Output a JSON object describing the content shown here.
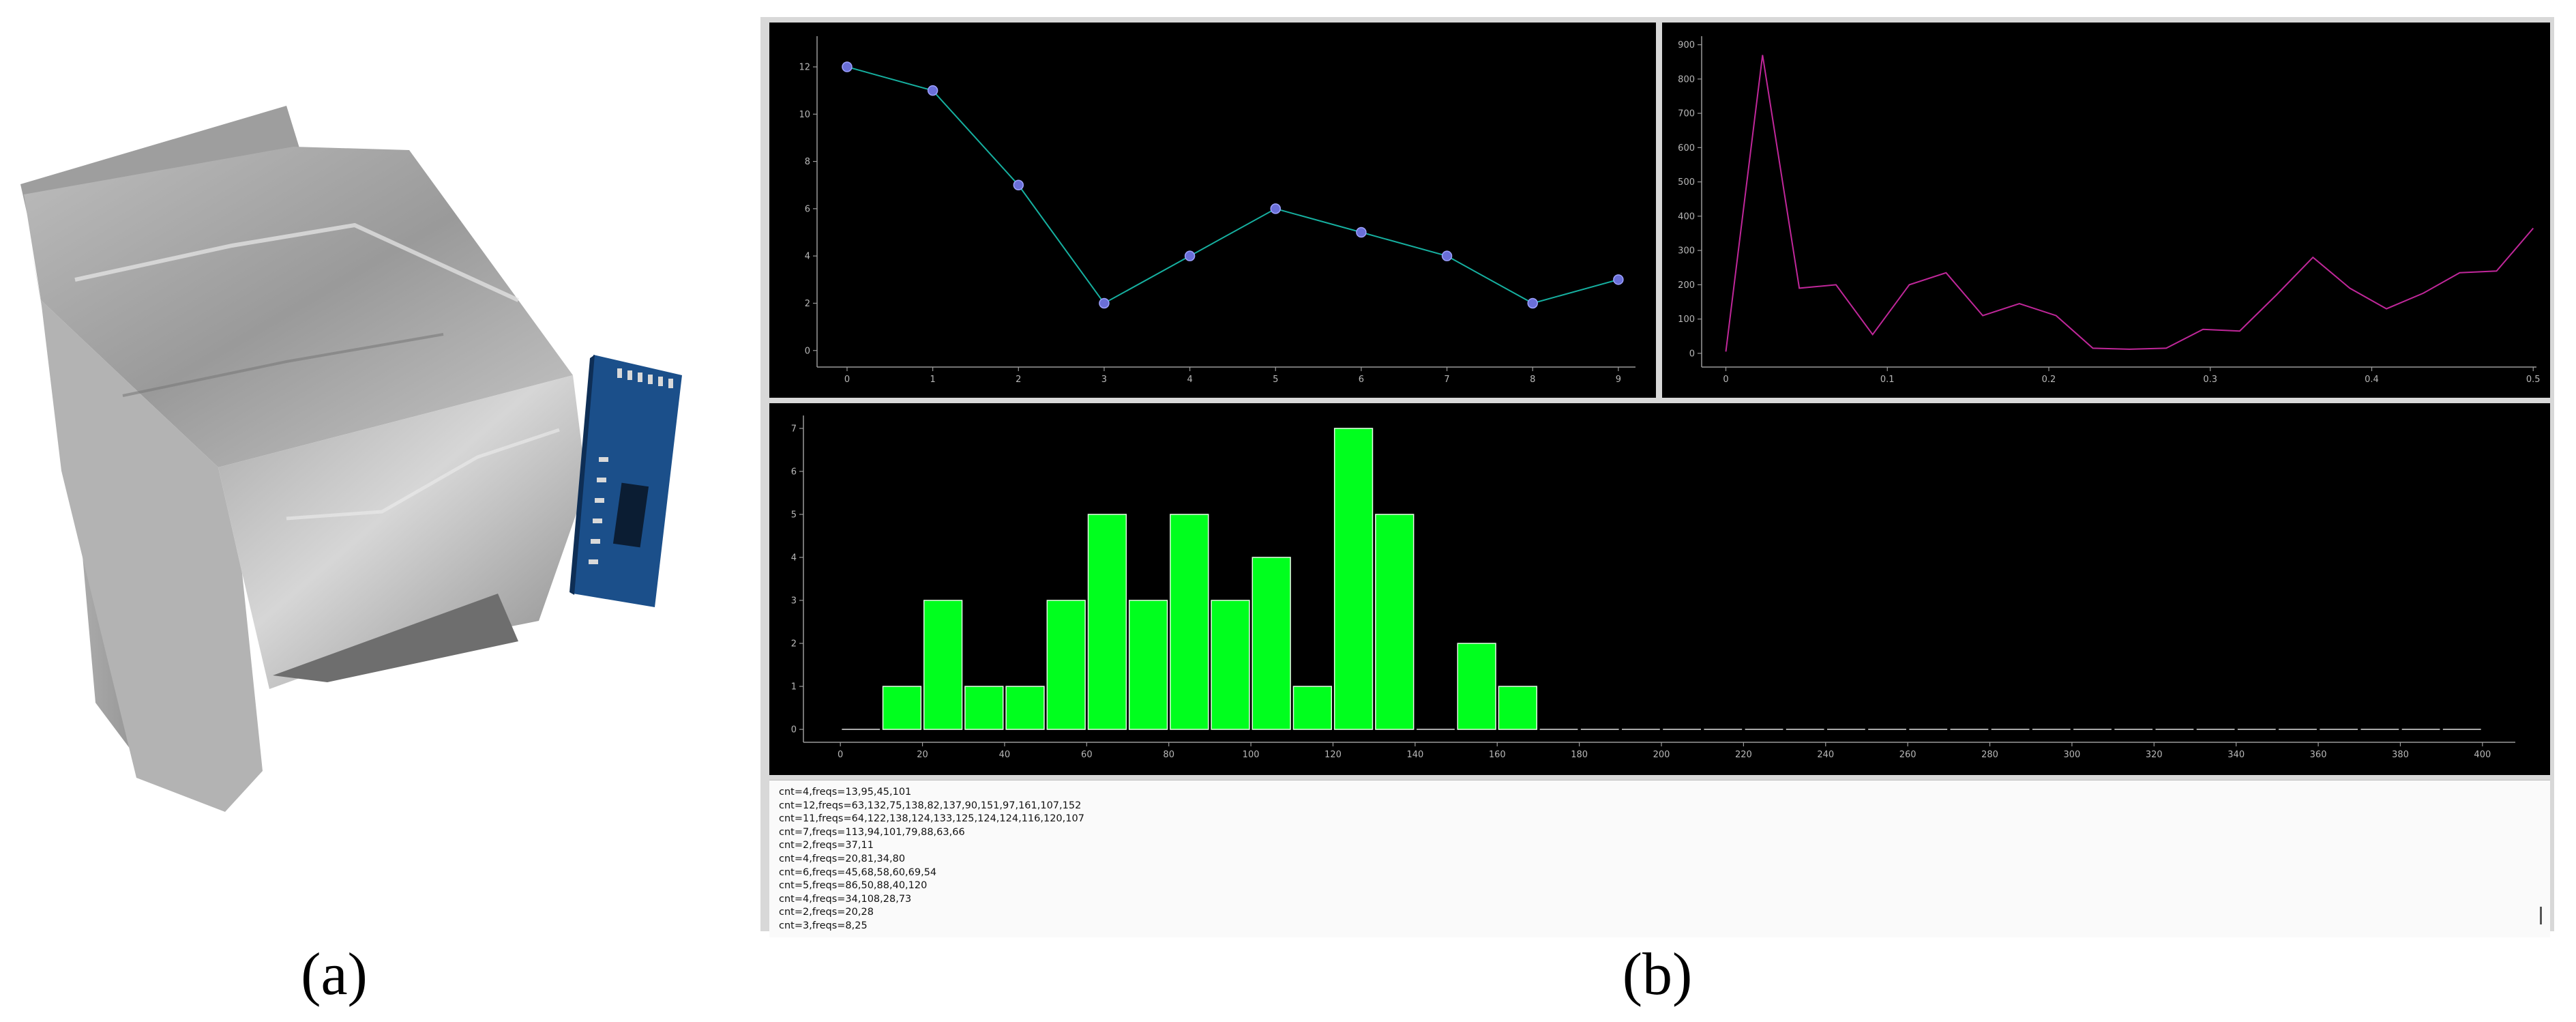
{
  "figure": {
    "caption_a": "(a)",
    "caption_b": "(b)"
  },
  "photo": {
    "subject": "foil-wrapped-sensor-box-with-blue-circuit-board",
    "colors": {
      "foil": "#c4c4c4",
      "board": "#1b4f8a"
    }
  },
  "app": {
    "colors": {
      "background": "#000000",
      "frame": "#d8d8d8",
      "axis": "#9a9a9a"
    },
    "log": {
      "lines": [
        "cnt=4,freqs=13,95,45,101",
        "cnt=12,freqs=63,132,75,138,82,137,90,151,97,161,107,152",
        "cnt=11,freqs=64,122,138,124,133,125,124,124,116,120,107",
        "cnt=7,freqs=113,94,101,79,88,63,66",
        "cnt=2,freqs=37,11",
        "cnt=4,freqs=20,81,34,80",
        "cnt=6,freqs=45,68,58,60,69,54",
        "cnt=5,freqs=86,50,88,40,120",
        "cnt=4,freqs=34,108,28,73",
        "cnt=2,freqs=20,28",
        "cnt=3,freqs=8,25"
      ]
    }
  },
  "chart_data": [
    {
      "type": "line",
      "x": [
        0,
        1,
        2,
        3,
        4,
        5,
        6,
        7,
        8,
        9
      ],
      "y": [
        12,
        11,
        7,
        2,
        4,
        6,
        5,
        4,
        2,
        3
      ],
      "xlim": [
        -0.35,
        9.2
      ],
      "ylim": [
        -0.7,
        13.3
      ],
      "xticks": [
        0,
        1,
        2,
        3,
        4,
        5,
        6,
        7,
        8,
        9
      ],
      "yticks": [
        0,
        2,
        4,
        6,
        8,
        10,
        12
      ],
      "markers": true,
      "color": "#16b0a0",
      "marker_color": "#6a6fd8",
      "title": "",
      "xlabel": "",
      "ylabel": ""
    },
    {
      "type": "line",
      "x": [
        0,
        0.0227,
        0.0455,
        0.0682,
        0.0909,
        0.1136,
        0.1364,
        0.1591,
        0.1818,
        0.2045,
        0.2273,
        0.25,
        0.2727,
        0.2955,
        0.3182,
        0.3409,
        0.3636,
        0.3864,
        0.4091,
        0.4318,
        0.4545,
        0.4773,
        0.5
      ],
      "y": [
        5,
        870,
        190,
        200,
        55,
        200,
        235,
        110,
        145,
        110,
        15,
        12,
        15,
        70,
        65,
        170,
        280,
        190,
        130,
        175,
        235,
        240,
        365
      ],
      "xlim": [
        -0.015,
        0.502
      ],
      "ylim": [
        -40,
        925
      ],
      "xticks": [
        0,
        0.1,
        0.2,
        0.3,
        0.4,
        0.5
      ],
      "yticks": [
        0,
        100,
        200,
        300,
        400,
        500,
        600,
        700,
        800,
        900
      ],
      "markers": false,
      "color": "#c0279a",
      "title": "",
      "xlabel": "",
      "ylabel": ""
    },
    {
      "type": "bar",
      "x": [
        0,
        10,
        20,
        30,
        40,
        50,
        60,
        70,
        80,
        90,
        100,
        110,
        120,
        130,
        140,
        150,
        160,
        170,
        180,
        190,
        200,
        210,
        220,
        230,
        240,
        250,
        260,
        270,
        280,
        290,
        300,
        310,
        320,
        330,
        340,
        350,
        360,
        370,
        380,
        390
      ],
      "values": [
        0,
        1,
        3,
        1,
        1,
        3,
        5,
        3,
        5,
        3,
        4,
        1,
        7,
        5,
        0,
        2,
        1,
        0,
        0,
        0,
        0,
        0,
        0,
        0,
        0,
        0,
        0,
        0,
        0,
        0,
        0,
        0,
        0,
        0,
        0,
        0,
        0,
        0,
        0,
        0
      ],
      "bin_width": 10,
      "xlim": [
        -9,
        408
      ],
      "ylim": [
        -0.3,
        7.3
      ],
      "xticks": [
        0,
        20,
        40,
        60,
        80,
        100,
        120,
        140,
        160,
        180,
        200,
        220,
        240,
        260,
        280,
        300,
        320,
        340,
        360,
        380,
        400
      ],
      "yticks": [
        0,
        1,
        2,
        3,
        4,
        5,
        6,
        7
      ],
      "color": "#00ff1e",
      "title": "",
      "xlabel": "",
      "ylabel": ""
    }
  ]
}
